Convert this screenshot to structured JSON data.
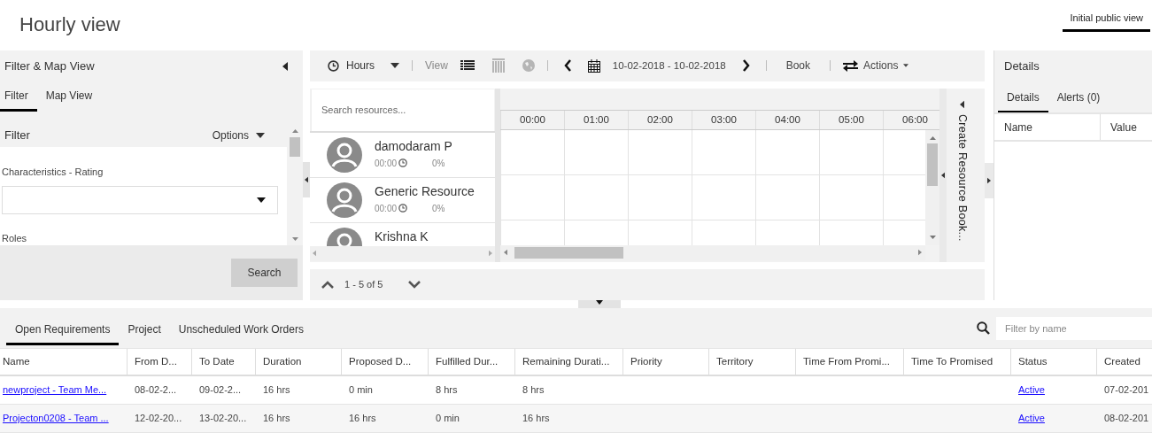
{
  "page_title": "Hourly view",
  "views": [
    {
      "label": "Initial public view",
      "selected": true
    }
  ],
  "filter_panel": {
    "title": "Filter & Map View",
    "tabs": [
      {
        "label": "Filter",
        "selected": true
      },
      {
        "label": "Map View",
        "selected": false
      }
    ],
    "section_title": "Filter",
    "options_label": "Options",
    "fields": [
      {
        "label": "Characteristics - Rating",
        "kind": "dropdown"
      },
      {
        "label": "Roles",
        "kind": "heading"
      }
    ],
    "search_button": "Search"
  },
  "toolbar": {
    "period": "Hours",
    "view_label": "View",
    "view_modes": [
      {
        "kind": "list",
        "selected": true
      },
      {
        "kind": "columns",
        "selected": false
      },
      {
        "kind": "map",
        "selected": false
      }
    ],
    "date_range": "10-02-2018 - 10-02-2018",
    "book": "Book",
    "actions": "Actions"
  },
  "resources": {
    "search_placeholder": "Search resources...",
    "items": [
      {
        "name": "damodaram P",
        "time": "00:00",
        "utilization": "0%"
      },
      {
        "name": "Generic Resource",
        "time": "00:00",
        "utilization": "0%"
      },
      {
        "name": "Krishna K"
      }
    ],
    "pager": "1 - 5 of 5"
  },
  "timeline": {
    "hours": [
      "00:00",
      "01:00",
      "02:00",
      "03:00",
      "04:00",
      "05:00",
      "06:00"
    ]
  },
  "side_tab": "Create Resource Book...",
  "details_panel": {
    "title": "Details",
    "tabs": [
      {
        "label": "Details",
        "selected": true
      },
      {
        "label": "Alerts (0)",
        "selected": false
      }
    ],
    "columns": [
      "Name",
      "Value"
    ]
  },
  "requirements": {
    "tabs": [
      {
        "label": "Open Requirements",
        "selected": true
      },
      {
        "label": "Project",
        "selected": false
      },
      {
        "label": "Unscheduled Work Orders",
        "selected": false
      }
    ],
    "filter_placeholder": "Filter by name",
    "columns": [
      {
        "label": "Name",
        "kind": "link"
      },
      {
        "label": "From D...",
        "kind": "text"
      },
      {
        "label": "To Date",
        "kind": "text"
      },
      {
        "label": "Duration",
        "kind": "text"
      },
      {
        "label": "Proposed D...",
        "kind": "text"
      },
      {
        "label": "Fulfilled Dur...",
        "kind": "text"
      },
      {
        "label": "Remaining Durati...",
        "kind": "text"
      },
      {
        "label": "Priority",
        "kind": "text"
      },
      {
        "label": "Territory",
        "kind": "text"
      },
      {
        "label": "Time From Promi...",
        "kind": "text"
      },
      {
        "label": "Time To Promised",
        "kind": "text"
      },
      {
        "label": "Status",
        "kind": "link"
      },
      {
        "label": "Created",
        "kind": "text"
      }
    ],
    "rows": [
      {
        "cells": [
          "newproject - Team Me...",
          "08-02-2...",
          "09-02-2...",
          "16 hrs",
          "0 min",
          "8 hrs",
          "8 hrs",
          null,
          null,
          null,
          null,
          "Active",
          "07-02-201"
        ]
      },
      {
        "cells": [
          "Projecton0208 - Team ...",
          "12-02-20...",
          "13-02-20...",
          "16 hrs",
          "16 hrs",
          "0 min",
          "16 hrs",
          null,
          null,
          null,
          null,
          "Active",
          "08-02-201"
        ]
      }
    ]
  }
}
